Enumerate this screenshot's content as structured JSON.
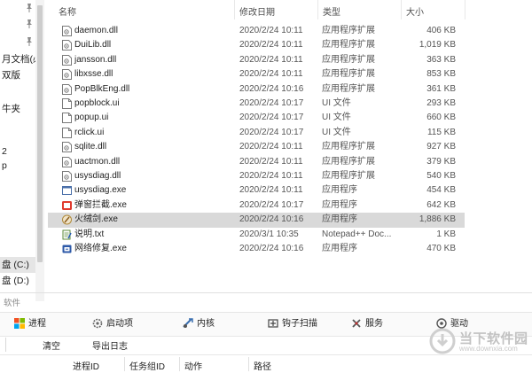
{
  "nav_pane": {
    "items": [
      {
        "label": "",
        "pinned": true
      },
      {
        "label": "",
        "pinned": true
      },
      {
        "label": "",
        "pinned": true
      },
      {
        "label": "月文档(必",
        "pinned": false
      },
      {
        "label": "双版",
        "pinned": false
      },
      {
        "label": "",
        "pinned": false
      },
      {
        "label": "牛夹",
        "pinned": false
      },
      {
        "label": "",
        "pinned": false
      },
      {
        "label": "",
        "pinned": false
      },
      {
        "label": "2",
        "pinned": false
      },
      {
        "label": "p",
        "pinned": false
      },
      {
        "label": "盘 (C:)",
        "pinned": false,
        "selected": true
      },
      {
        "label": "盘 (D:)",
        "pinned": false
      }
    ]
  },
  "file_list": {
    "columns": {
      "name": "名称",
      "date": "修改日期",
      "type": "类型",
      "size": "大小"
    },
    "rows": [
      {
        "name": "daemon.dll",
        "date": "2020/2/24 10:11",
        "type": "应用程序扩展",
        "size": "406 KB",
        "icon": "dll-file-icon"
      },
      {
        "name": "DuiLib.dll",
        "date": "2020/2/24 10:11",
        "type": "应用程序扩展",
        "size": "1,019 KB",
        "icon": "dll-file-icon"
      },
      {
        "name": "jansson.dll",
        "date": "2020/2/24 10:11",
        "type": "应用程序扩展",
        "size": "363 KB",
        "icon": "dll-file-icon"
      },
      {
        "name": "libxsse.dll",
        "date": "2020/2/24 10:11",
        "type": "应用程序扩展",
        "size": "853 KB",
        "icon": "dll-file-icon"
      },
      {
        "name": "PopBlkEng.dll",
        "date": "2020/2/24 10:16",
        "type": "应用程序扩展",
        "size": "361 KB",
        "icon": "dll-file-icon"
      },
      {
        "name": "popblock.ui",
        "date": "2020/2/24 10:17",
        "type": "UI 文件",
        "size": "293 KB",
        "icon": "blank-file-icon"
      },
      {
        "name": "popup.ui",
        "date": "2020/2/24 10:17",
        "type": "UI 文件",
        "size": "660 KB",
        "icon": "blank-file-icon"
      },
      {
        "name": "rclick.ui",
        "date": "2020/2/24 10:17",
        "type": "UI 文件",
        "size": "115 KB",
        "icon": "blank-file-icon"
      },
      {
        "name": "sqlite.dll",
        "date": "2020/2/24 10:11",
        "type": "应用程序扩展",
        "size": "927 KB",
        "icon": "dll-file-icon"
      },
      {
        "name": "uactmon.dll",
        "date": "2020/2/24 10:11",
        "type": "应用程序扩展",
        "size": "379 KB",
        "icon": "dll-file-icon"
      },
      {
        "name": "usysdiag.dll",
        "date": "2020/2/24 10:11",
        "type": "应用程序扩展",
        "size": "540 KB",
        "icon": "dll-file-icon"
      },
      {
        "name": "usysdiag.exe",
        "date": "2020/2/24 10:11",
        "type": "应用程序",
        "size": "454 KB",
        "icon": "exe-window-icon"
      },
      {
        "name": "弹窗拦截.exe",
        "date": "2020/2/24 10:17",
        "type": "应用程序",
        "size": "642 KB",
        "icon": "popup-block-icon"
      },
      {
        "name": "火绒剑.exe",
        "date": "2020/2/24 10:16",
        "type": "应用程序",
        "size": "1,886 KB",
        "icon": "huorong-sword-icon",
        "selected": true
      },
      {
        "name": "说明.txt",
        "date": "2020/3/1 10:35",
        "type": "Notepad++ Doc...",
        "size": "1 KB",
        "icon": "notepad-icon"
      },
      {
        "name": "网络修复.exe",
        "date": "2020/2/24 10:16",
        "type": "应用程序",
        "size": "470 KB",
        "icon": "network-repair-icon"
      }
    ]
  },
  "tool": {
    "title": "软件",
    "tabs": [
      {
        "label": "进程",
        "icon": "windows-logo-icon"
      },
      {
        "label": "启动项",
        "icon": "startup-gear-icon"
      },
      {
        "label": "内核",
        "icon": "kernel-icon"
      },
      {
        "label": "钩子扫描",
        "icon": "hook-scan-icon"
      },
      {
        "label": "服务",
        "icon": "service-icon"
      },
      {
        "label": "驱动",
        "icon": "driver-icon"
      }
    ],
    "actions": {
      "clear": "清空",
      "export": "导出日志"
    },
    "columns": {
      "pid": "进程ID",
      "tid": "任务组ID",
      "action": "动作",
      "path": "路径"
    }
  },
  "watermark": {
    "text": "当下软件园",
    "url": "www.downxia.com"
  }
}
